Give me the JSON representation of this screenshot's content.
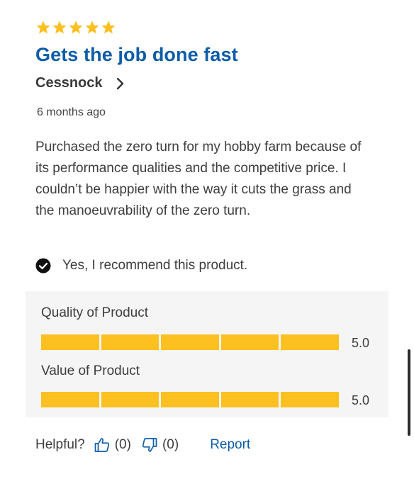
{
  "review": {
    "rating": 5,
    "rating_max": 5,
    "title": "Gets the job done fast",
    "author": "Cessnock",
    "date": "6 months ago",
    "body": "Purchased the zero turn for my hobby farm because of its performance qualities and the competitive price. I couldn’t be happier with the way it cuts the grass and the manoeuvrability of the zero turn.",
    "recommend_text": "Yes, I recommend this product."
  },
  "ratings": [
    {
      "label": "Quality of Product",
      "value": 5.0,
      "value_text": "5.0",
      "max": 5
    },
    {
      "label": "Value of Product",
      "value": 5.0,
      "value_text": "5.0",
      "max": 5
    }
  ],
  "feedback": {
    "helpful_label": "Helpful?",
    "up_count": "(0)",
    "down_count": "(0)",
    "report_label": "Report"
  },
  "icons": {
    "star": "star-icon",
    "author_link": "chevron-right-icon",
    "recommend": "check-circle-icon",
    "up": "thumbs-up-icon",
    "down": "thumbs-down-icon"
  },
  "colors": {
    "title": "#0d5ca8",
    "star": "#fcc020",
    "bar_fill": "#fcc020",
    "link": "#0d5ca8",
    "panel": "#f5f5f5"
  }
}
